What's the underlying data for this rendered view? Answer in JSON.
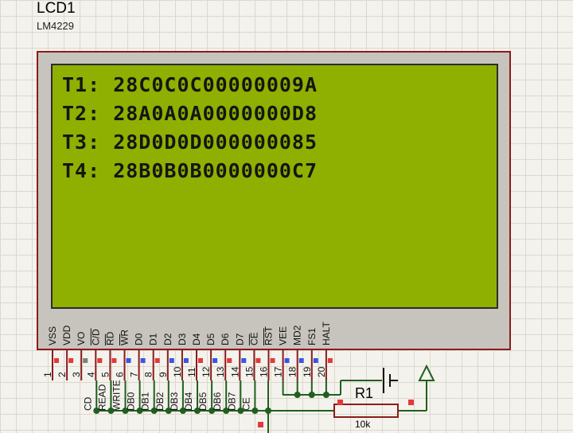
{
  "component": {
    "name": "LCD1",
    "part": "LM4229"
  },
  "display": {
    "lines": [
      "T1: 28C0C0C00000009A",
      "T2: 28A0A0A0000000D8",
      "T3: 28D0D0D000000085",
      "T4: 28B0B0B0000000C7"
    ]
  },
  "pins": [
    {
      "num": "1",
      "label": "VSS",
      "overline": false,
      "net": ""
    },
    {
      "num": "2",
      "label": "VDD",
      "overline": false,
      "net": ""
    },
    {
      "num": "3",
      "label": "VO",
      "overline": false,
      "net": ""
    },
    {
      "num": "4",
      "label": "C/D",
      "overline": true,
      "net": "CD"
    },
    {
      "num": "5",
      "label": "RD",
      "overline": true,
      "net": "READ"
    },
    {
      "num": "6",
      "label": "WR",
      "overline": true,
      "net": "WRITE"
    },
    {
      "num": "7",
      "label": "D0",
      "overline": false,
      "net": "DB0"
    },
    {
      "num": "8",
      "label": "D1",
      "overline": false,
      "net": "DB1"
    },
    {
      "num": "9",
      "label": "D2",
      "overline": false,
      "net": "DB2"
    },
    {
      "num": "10",
      "label": "D3",
      "overline": false,
      "net": "DB3"
    },
    {
      "num": "11",
      "label": "D4",
      "overline": false,
      "net": "DB4"
    },
    {
      "num": "12",
      "label": "D5",
      "overline": false,
      "net": "DB5"
    },
    {
      "num": "13",
      "label": "D6",
      "overline": false,
      "net": "DB6"
    },
    {
      "num": "14",
      "label": "D7",
      "overline": false,
      "net": "DB7"
    },
    {
      "num": "15",
      "label": "CE",
      "overline": true,
      "net": "CE"
    },
    {
      "num": "16",
      "label": "RST",
      "overline": true,
      "net": ""
    },
    {
      "num": "17",
      "label": "VEE",
      "overline": false,
      "net": ""
    },
    {
      "num": "18",
      "label": "MD2",
      "overline": false,
      "net": ""
    },
    {
      "num": "19",
      "label": "FS1",
      "overline": false,
      "net": ""
    },
    {
      "num": "20",
      "label": "HALT",
      "overline": false,
      "net": ""
    }
  ],
  "resistor": {
    "name": "R1",
    "value": "10k"
  },
  "colors": {
    "wire": "#1f5f1f",
    "pin_red": "#e23a3a",
    "pin_blue": "#3a55e2",
    "pin_gray": "#808080",
    "lcd_screen": "#8fb000",
    "frame_border": "#8a1c1c"
  }
}
